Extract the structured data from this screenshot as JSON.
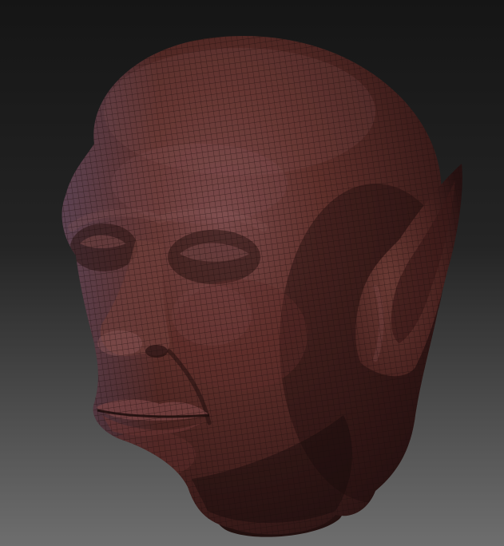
{
  "viewport": {
    "background_top": "#151515",
    "background_bottom": "#6e6e6e"
  },
  "model": {
    "subject": "elf-head-sculpt",
    "display": "wireframe-over-shaded",
    "colors": {
      "skin_base": "#5a2b26",
      "skin_shadow": "#2c1414",
      "skin_highlight": "#7a4a4a",
      "rim_light": "#6a5a78",
      "wire": "#1a0d0c"
    }
  }
}
